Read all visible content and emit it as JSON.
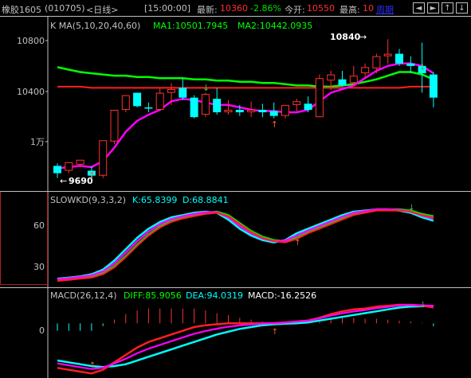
{
  "header": {
    "symbol": "橡胶1605",
    "code": "(010705)",
    "period": "<日线>",
    "time": "[15:00:00]",
    "last_label": "最新:",
    "last_value": "10360",
    "change_pct": "-2.86%",
    "open_label": "今开:",
    "open_value": "10550",
    "high_label": "最高:",
    "high_value": "10",
    "cycle_link": "周期"
  },
  "nav_buttons": [
    {
      "name": "prev-button",
      "glyph": "◄"
    },
    {
      "name": "next-button",
      "glyph": "►"
    },
    {
      "name": "zoom-in-button",
      "glyph": "↑"
    },
    {
      "name": "zoom-out-button",
      "glyph": "↓"
    }
  ],
  "price_panel": {
    "title": "K  MA(5,10,20,40,60)",
    "ma1": "MA1:10501.7945",
    "ma2": "MA2:10442.0935",
    "y_labels": [
      "10800",
      "10400",
      "1万"
    ],
    "high_marker": "10840",
    "low_marker": "9690"
  },
  "kd_panel": {
    "title": "SLOWKD(9,3,3,2)",
    "k": "K:65.8399",
    "d": "D:68.8841",
    "y_labels": [
      "60",
      "30"
    ]
  },
  "macd_panel": {
    "title": "MACD(26,12,4)",
    "diff": "DIFF:85.9056",
    "dea": "DEA:94.0319",
    "macd": "MACD:-16.2526",
    "y_labels": [
      "0"
    ]
  },
  "colors": {
    "up": "#ff3030",
    "down": "#00ffff",
    "ma1": "#ff00ff",
    "ma2": "#00ff00",
    "ma_red": "#ff2020",
    "border": "#c0c0c0",
    "panel_border": "#b02020"
  },
  "chart_data": {
    "type": "candlestick",
    "candles": [
      {
        "o": 9800,
        "h": 9820,
        "c": 9740,
        "l": 9700
      },
      {
        "o": 9760,
        "h": 9820,
        "c": 9830,
        "l": 9740
      },
      {
        "o": 9810,
        "h": 9840,
        "c": 9850,
        "l": 9790
      },
      {
        "o": 9760,
        "h": 9800,
        "c": 9720,
        "l": 9690
      },
      {
        "o": 9720,
        "h": 10000,
        "c": 10010,
        "l": 9700
      },
      {
        "o": 10000,
        "h": 10120,
        "c": 10260,
        "l": 9980
      },
      {
        "o": 10260,
        "h": 10380,
        "c": 10380,
        "l": 10240
      },
      {
        "o": 10400,
        "h": 10400,
        "c": 10290,
        "l": 10280
      },
      {
        "o": 10280,
        "h": 10320,
        "c": 10270,
        "l": 10240
      },
      {
        "o": 10260,
        "h": 10440,
        "c": 10400,
        "l": 10250
      },
      {
        "o": 10400,
        "h": 10480,
        "c": 10430,
        "l": 10300
      },
      {
        "o": 10440,
        "h": 10520,
        "c": 10360,
        "l": 10340
      },
      {
        "o": 10360,
        "h": 10380,
        "c": 10200,
        "l": 10190
      },
      {
        "o": 10220,
        "h": 10400,
        "c": 10390,
        "l": 10200
      },
      {
        "o": 10350,
        "h": 10440,
        "c": 10240,
        "l": 10220
      },
      {
        "o": 10240,
        "h": 10340,
        "c": 10260,
        "l": 10220
      },
      {
        "o": 10260,
        "h": 10300,
        "c": 10240,
        "l": 10210
      },
      {
        "o": 10240,
        "h": 10330,
        "c": 10260,
        "l": 10200
      },
      {
        "o": 10260,
        "h": 10310,
        "c": 10240,
        "l": 10200
      },
      {
        "o": 10250,
        "h": 10320,
        "c": 10210,
        "l": 10190
      },
      {
        "o": 10210,
        "h": 10260,
        "c": 10300,
        "l": 10190
      },
      {
        "o": 10300,
        "h": 10350,
        "c": 10330,
        "l": 10250
      },
      {
        "o": 10310,
        "h": 10370,
        "c": 10260,
        "l": 10240
      },
      {
        "o": 10200,
        "h": 10550,
        "c": 10520,
        "l": 10200
      },
      {
        "o": 10500,
        "h": 10580,
        "c": 10550,
        "l": 10420
      },
      {
        "o": 10510,
        "h": 10580,
        "c": 10460,
        "l": 10450
      },
      {
        "o": 10480,
        "h": 10620,
        "c": 10540,
        "l": 10460
      },
      {
        "o": 10560,
        "h": 10640,
        "c": 10610,
        "l": 10520
      },
      {
        "o": 10600,
        "h": 10720,
        "c": 10700,
        "l": 10560
      },
      {
        "o": 10700,
        "h": 10840,
        "c": 10720,
        "l": 10640
      },
      {
        "o": 10720,
        "h": 10760,
        "c": 10640,
        "l": 10620
      },
      {
        "o": 10640,
        "h": 10700,
        "c": 10620,
        "l": 10560
      },
      {
        "o": 10620,
        "h": 10810,
        "c": 10560,
        "l": 10400
      },
      {
        "o": 10550,
        "h": 10570,
        "c": 10360,
        "l": 10280
      }
    ],
    "ma_magenta": [
      9780,
      9790,
      9800,
      9790,
      9840,
      9950,
      10080,
      10170,
      10220,
      10260,
      10330,
      10350,
      10340,
      10320,
      10300,
      10300,
      10280,
      10260,
      10250,
      10250,
      10240,
      10240,
      10260,
      10330,
      10400,
      10430,
      10460,
      10520,
      10580,
      10620,
      10640,
      10640,
      10620,
      10560
    ],
    "ma_green": [
      10610,
      10590,
      10570,
      10560,
      10550,
      10540,
      10540,
      10530,
      10530,
      10520,
      10520,
      10520,
      10510,
      10510,
      10500,
      10500,
      10490,
      10490,
      10480,
      10480,
      10470,
      10460,
      10460,
      10450,
      10450,
      10460,
      10470,
      10490,
      10510,
      10540,
      10570,
      10570,
      10550,
      10510
    ],
    "ma_red": [
      10450,
      10450,
      10450,
      10440,
      10440,
      10440,
      10440,
      10440,
      10440,
      10440,
      10440,
      10440,
      10440,
      10440,
      10440,
      10440,
      10440,
      10440,
      10440,
      10440,
      10440,
      10440,
      10440,
      10440,
      10440,
      10440,
      10440,
      10440,
      10440,
      10440,
      10440,
      10450,
      10450,
      10450
    ],
    "kd_k": [
      14,
      15,
      16,
      18,
      22,
      30,
      40,
      50,
      58,
      64,
      68,
      70,
      72,
      73,
      72,
      66,
      58,
      52,
      48,
      46,
      48,
      54,
      58,
      62,
      66,
      70,
      73,
      74,
      75,
      75,
      74,
      72,
      68,
      65
    ],
    "kd_d": [
      13,
      14,
      15,
      16,
      19,
      25,
      34,
      44,
      53,
      60,
      65,
      68,
      70,
      72,
      73,
      70,
      63,
      56,
      51,
      48,
      47,
      50,
      55,
      59,
      63,
      67,
      71,
      73,
      75,
      75,
      75,
      74,
      71,
      69
    ],
    "macd_diff": [
      -240,
      -250,
      -260,
      -270,
      -250,
      -210,
      -170,
      -130,
      -100,
      -80,
      -60,
      -40,
      -20,
      -10,
      -5,
      0,
      0,
      0,
      0,
      0,
      5,
      10,
      15,
      30,
      50,
      65,
      75,
      80,
      90,
      95,
      100,
      100,
      95,
      86
    ],
    "macd_dea": [
      -200,
      -210,
      -220,
      -230,
      -235,
      -230,
      -220,
      -200,
      -180,
      -160,
      -140,
      -120,
      -100,
      -80,
      -60,
      -45,
      -30,
      -20,
      -10,
      -5,
      -2,
      0,
      5,
      15,
      25,
      35,
      45,
      55,
      65,
      75,
      85,
      90,
      92,
      94
    ],
    "macd_hist": [
      -40,
      -40,
      -40,
      -40,
      -15,
      20,
      50,
      70,
      80,
      80,
      80,
      80,
      80,
      70,
      55,
      45,
      30,
      20,
      10,
      5,
      7,
      10,
      10,
      15,
      25,
      30,
      30,
      25,
      25,
      20,
      15,
      10,
      3,
      -16
    ],
    "y_range_price": [
      9620,
      10900
    ],
    "y_range_kd": [
      10,
      80
    ],
    "y_range_macd": [
      -290,
      130
    ]
  }
}
